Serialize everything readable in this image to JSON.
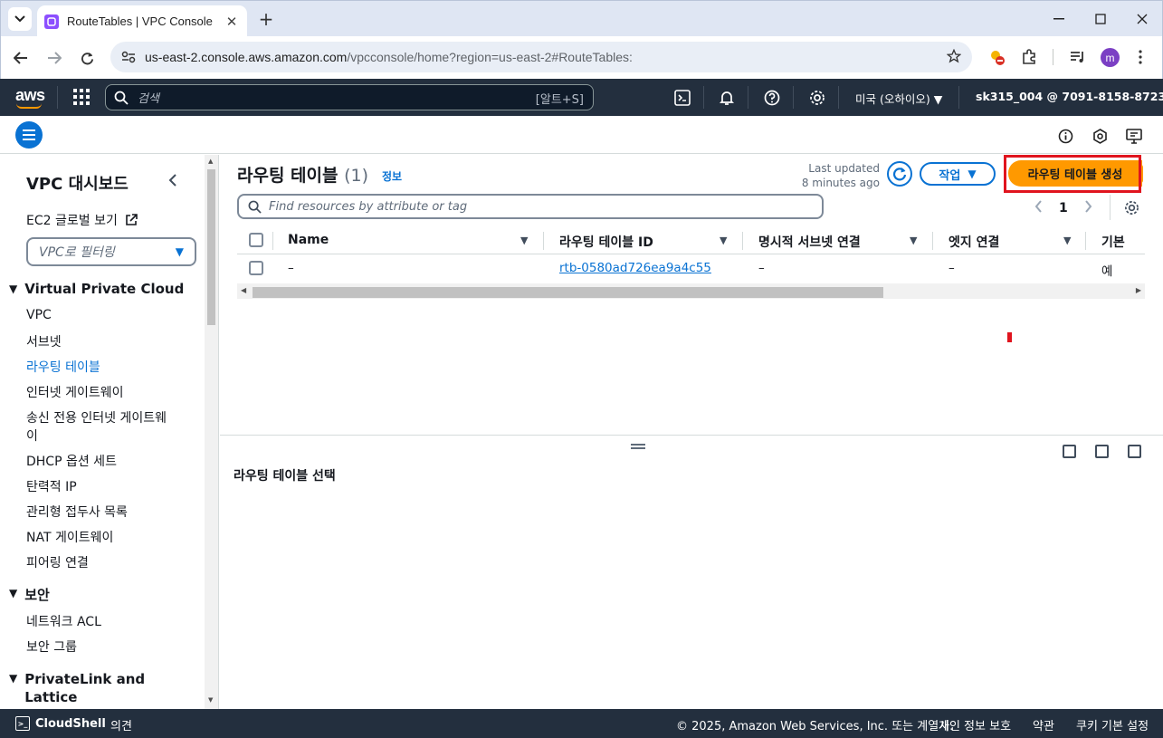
{
  "browser": {
    "tab_title": "RouteTables | VPC Console",
    "url_host": "us-east-2.console.aws.amazon.com",
    "url_rest": "/vpcconsole/home?region=us-east-2#RouteTables:",
    "profile_initial": "m"
  },
  "aws_header": {
    "logo": "aws",
    "search_placeholder": "검색",
    "search_shortcut": "[알트+S]",
    "region": "미국 (오하이오) ▼",
    "account": "sk315_004 @ 7091-8158-8723 ▼"
  },
  "sidebar": {
    "title": "VPC 대시보드",
    "ec2_global": "EC2 글로벌 보기",
    "filter_placeholder": "VPC로 필터링",
    "section_vpc": "Virtual Private Cloud",
    "vpc_items": [
      "VPC",
      "서브넷",
      "라우팅 테이블",
      "인터넷 게이트웨이",
      "송신 전용 인터넷 게이트웨",
      "이",
      "DHCP 옵션 세트",
      "탄력적 IP",
      "관리형 접두사 목록",
      "NAT 게이트웨이",
      "피어링 연결"
    ],
    "section_security": "보안",
    "security_items": [
      "네트워크 ACL",
      "보안 그룹"
    ],
    "section_privatelink": "PrivateLink and",
    "section_privatelink_2": "Lattice"
  },
  "main": {
    "title": "라우팅 테이블",
    "count": "(1)",
    "info": "정보",
    "last_updated_label": "Last updated",
    "last_updated_value": "8 minutes ago",
    "actions_label": "작업",
    "create_label": "라우팅 테이블 생성",
    "search_placeholder": "Find resources by attribute or tag",
    "page_number": "1",
    "columns": [
      "Name",
      "라우팅 테이블 ID",
      "명시적 서브넷 연결",
      "엣지 연결",
      "기본"
    ],
    "row": {
      "name": "–",
      "id": "rtb-0580ad726ea9a4c55",
      "explicit_subnet": "–",
      "edge": "–",
      "main": "예"
    },
    "split_title": "라우팅 테이블 선택"
  },
  "footer": {
    "cloudshell": "CloudShell",
    "feedback": "의견",
    "copyright": "© 2025, Amazon Web Services, Inc. 또는 계열사.",
    "privacy": "개인 정보 보호",
    "terms": "약관",
    "cookies": "쿠키 기본 설정"
  },
  "colors": {
    "aws_nav": "#232f3e",
    "link_blue": "#0972d3",
    "primary_orange": "#ff9900",
    "highlight_red": "#e0141e"
  }
}
